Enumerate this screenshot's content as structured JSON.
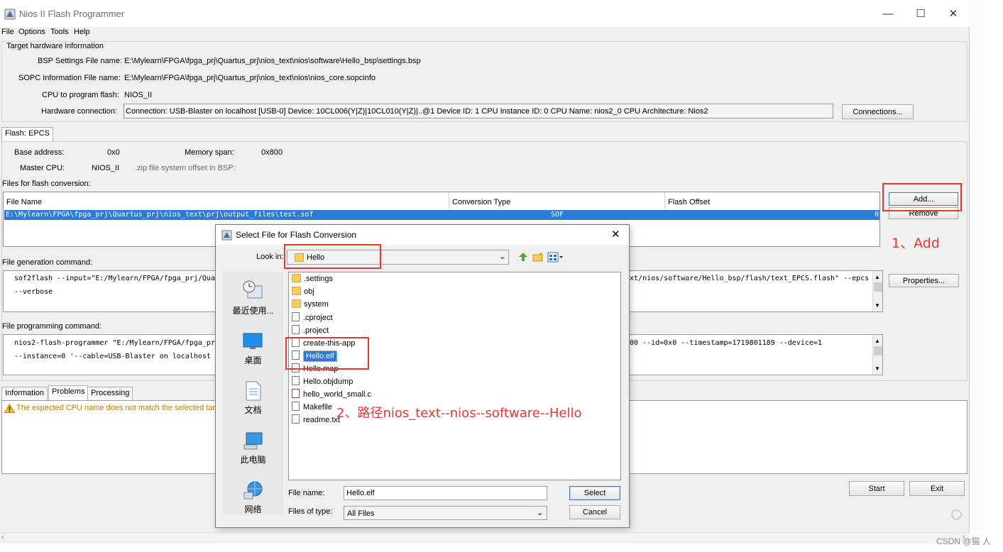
{
  "window": {
    "title": "Nios II Flash Programmer",
    "controls": {
      "minimize": "—",
      "maximize": "☐",
      "close": "✕"
    }
  },
  "menu": [
    "File",
    "Options",
    "Tools",
    "Help"
  ],
  "target": {
    "group_title": "Target hardware information",
    "bsp_label": "BSP Settings File name:",
    "bsp_value": "E:\\Mylearn\\FPGA\\fpga_prj\\Quartus_prj\\nios_text\\nios\\software\\Hello_bsp\\settings.bsp",
    "sopc_label": "SOPC Information File name:",
    "sopc_value": "E:\\Mylearn\\FPGA\\fpga_prj\\Quartus_prj\\nios_text\\nios\\nios_core.sopcinfo",
    "cpu_label": "CPU to program flash:",
    "cpu_value": "NIOS_II",
    "hw_label": "Hardware connection:",
    "hw_value": "Connection: USB-Blaster on localhost [USB-0]   Device: 10CL006(Y|Z)|10CL010(Y|Z)|..@1   Device ID: 1   CPU Instance ID: 0   CPU Name: nios2_0   CPU Architecture: Nios2",
    "connections_button": "Connections..."
  },
  "flash": {
    "tab": "Flash: EPCS",
    "base_label": "Base address:",
    "base_value": "0x0",
    "span_label": "Memory span:",
    "span_value": "0x800",
    "master_label": "Master CPU:",
    "master_value": "NIOS_II",
    "zip_label": ".zip file system offset in BSP:",
    "files_label": "Files for flash conversion:",
    "columns": [
      "File Name",
      "Conversion Type",
      "Flash Offset"
    ],
    "row": {
      "file": "E:\\Mylearn\\FPGA\\fpga_prj\\Quartus_prj\\nios_text\\prj\\output_files\\text.sof",
      "type": "SOF",
      "offset": "0"
    },
    "add_button": "Add...",
    "remove_button": "Remove",
    "properties_button": "Properties...",
    "gen_label": "File generation command:",
    "gen_line1_a": "sof2flash --input=\"E:/Mylearn/FPGA/fpga_prj/Quartu",
    "gen_line1_b": "ext/nios/software/Hello_bsp/flash/text_EPCS.flash\" --epcs",
    "gen_line2": "--verbose",
    "prog_label": "File programming command:",
    "prog_line1_a": "nios2-flash-programmer \"E:/Mylearn/FPGA/fpga_prj/Q",
    "prog_line1_b": "800 --id=0x0 --timestamp=1719801189 --device=1",
    "prog_line2": "--instance=0 '--cable=USB-Blaster on localhost [US"
  },
  "bottom": {
    "tabs": [
      "Information",
      "Problems",
      "Processing"
    ],
    "warning": "The expected CPU name does not match the selected targ",
    "start_button": "Start",
    "exit_button": "Exit"
  },
  "dialog": {
    "title": "Select File for Flash Conversion",
    "close": "✕",
    "look_in_label": "Look in:",
    "look_in_value": "Hello",
    "places": [
      "最近使用...",
      "桌面",
      "文档",
      "此电脑",
      "网络"
    ],
    "files": [
      {
        "name": ".settings",
        "kind": "folder"
      },
      {
        "name": "obj",
        "kind": "folder"
      },
      {
        "name": "system",
        "kind": "folder"
      },
      {
        "name": ".cproject",
        "kind": "file"
      },
      {
        "name": ".project",
        "kind": "file"
      },
      {
        "name": "create-this-app",
        "kind": "file"
      },
      {
        "name": "Hello.elf",
        "kind": "file"
      },
      {
        "name": "Hello.map",
        "kind": "file"
      },
      {
        "name": "Hello.objdump",
        "kind": "file"
      },
      {
        "name": "hello_world_small.c",
        "kind": "file"
      },
      {
        "name": "Makefile",
        "kind": "file"
      },
      {
        "name": "readme.txt",
        "kind": "file"
      }
    ],
    "file_name_label": "File name:",
    "file_name_value": "Hello.elf",
    "files_type_label": "Files of type:",
    "files_type_value": "All Files",
    "select_button": "Select",
    "cancel_button": "Cancel"
  },
  "annotations": {
    "step1": "1、Add",
    "step2": "2、路径nios_text--nios--software--Hello"
  },
  "watermark": "CSDN @猫 人",
  "colors": {
    "selection": "#2f7ad6",
    "annotation": "#e2382f",
    "warning": "#c07a00"
  }
}
